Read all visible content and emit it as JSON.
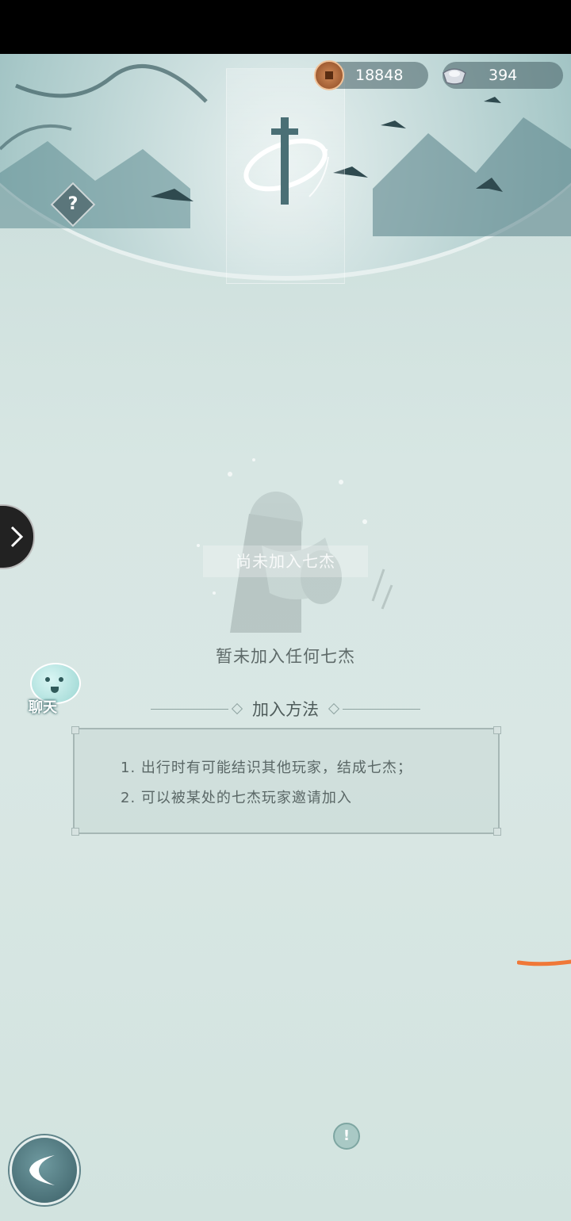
{
  "currencies": {
    "copper": {
      "icon": "copper-coin-icon",
      "value": "18848"
    },
    "silver": {
      "icon": "silver-ingot-icon",
      "value": "394"
    }
  },
  "help": {
    "label": "?"
  },
  "status": {
    "banner_label": "尚未加入七杰",
    "empty_message": "暂未加入任何七杰"
  },
  "chat": {
    "label": "聊天"
  },
  "join_methods": {
    "title": "加入方法",
    "items": [
      "1. 出行时有可能结识其他玩家，结成七杰；",
      "2. 可以被某处的七杰玩家邀请加入"
    ]
  },
  "info": {
    "label": "!"
  },
  "colors": {
    "statusbar": "#000000",
    "background": "#cfe0dd",
    "banner_teal": "#6f9ea2",
    "accent_orange": "#f07838"
  }
}
